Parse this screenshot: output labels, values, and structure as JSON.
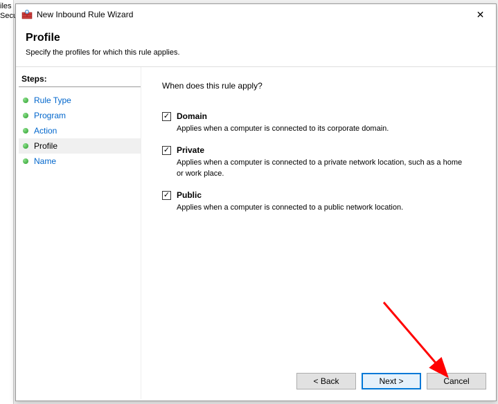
{
  "background": {
    "text1": "iles",
    "text2": "Secu"
  },
  "window": {
    "title": "New Inbound Rule Wizard",
    "close_symbol": "✕"
  },
  "header": {
    "title": "Profile",
    "subtitle": "Specify the profiles for which this rule applies."
  },
  "sidebar": {
    "steps_label": "Steps:",
    "items": [
      {
        "label": "Rule Type"
      },
      {
        "label": "Program"
      },
      {
        "label": "Action"
      },
      {
        "label": "Profile"
      },
      {
        "label": "Name"
      }
    ],
    "current_index": 3
  },
  "content": {
    "question": "When does this rule apply?",
    "checkmark": "✓",
    "options": [
      {
        "label": "Domain",
        "description": "Applies when a computer is connected to its corporate domain."
      },
      {
        "label": "Private",
        "description": "Applies when a computer is connected to a private network location, such as a home or work place."
      },
      {
        "label": "Public",
        "description": "Applies when a computer is connected to a public network location."
      }
    ]
  },
  "buttons": {
    "back": "< Back",
    "next": "Next >",
    "cancel": "Cancel"
  }
}
